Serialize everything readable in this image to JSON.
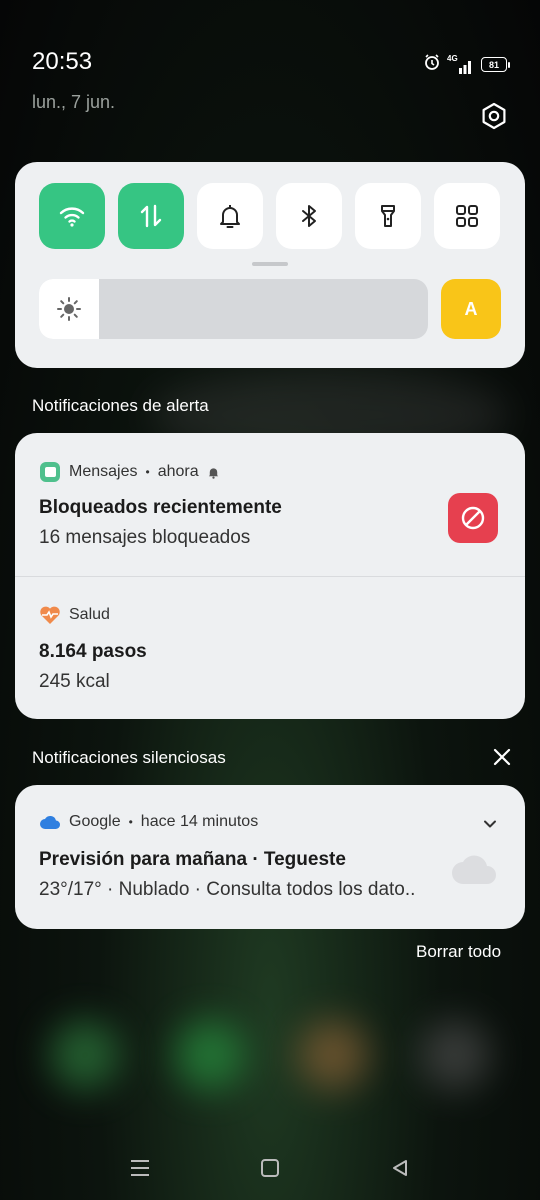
{
  "status_bar": {
    "time": "20:53",
    "network": "4G",
    "battery": "81",
    "icons": [
      "alarm-icon",
      "signal-icon",
      "battery-icon"
    ]
  },
  "date": "lun., 7 jun.",
  "quick_settings": {
    "tiles": [
      {
        "name": "wifi",
        "icon": "wifi-icon",
        "active": true
      },
      {
        "name": "mobile-data",
        "icon": "data-arrows-icon",
        "active": true
      },
      {
        "name": "sound",
        "icon": "bell-icon",
        "active": false
      },
      {
        "name": "bluetooth",
        "icon": "bluetooth-icon",
        "active": false
      },
      {
        "name": "flashlight",
        "icon": "flashlight-icon",
        "active": false
      },
      {
        "name": "more",
        "icon": "grid-icon",
        "active": false
      }
    ],
    "brightness_level": 0.15,
    "auto_brightness_label": "A",
    "colors": {
      "active": "#36c583",
      "auto": "#f9c518"
    }
  },
  "alert_section": {
    "title": "Notificaciones de alerta",
    "notifications": [
      {
        "app": "Mensajes",
        "time": "ahora",
        "title": "Bloqueados recientemente",
        "body": "16 mensajes bloqueados",
        "icon": "messages-icon",
        "action_icon": "block-icon"
      },
      {
        "app": "Salud",
        "title": "8.164 pasos",
        "body": "245 kcal",
        "icon": "heart-icon"
      }
    ]
  },
  "silent_section": {
    "title": "Notificaciones silenciosas",
    "notifications": [
      {
        "app": "Google",
        "time": "hace 14 minutos",
        "title": "Previsión para mañana · Tegueste",
        "body": "23°/17° · Nublado · Consulta todos los dato..",
        "icon": "cloud-icon"
      }
    ]
  },
  "clear_all": "Borrar todo",
  "separator": "•"
}
